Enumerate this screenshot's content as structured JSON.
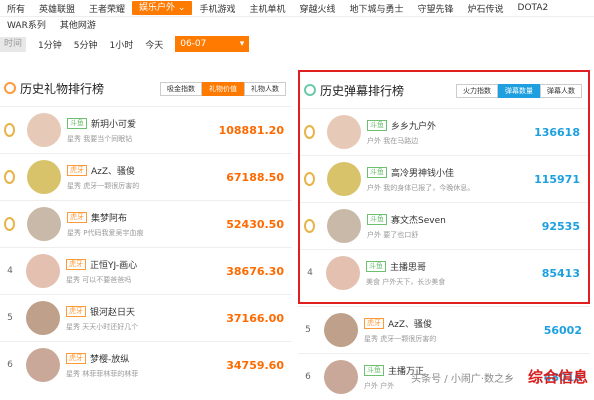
{
  "gamebar": {
    "items": [
      "所有",
      "英雄联盟",
      "王者荣耀",
      "娱乐户外 ⌄",
      "手机游戏",
      "主机单机",
      "穿越火线",
      "地下城与勇士",
      "守望先锋",
      "炉石传说",
      "DOTA2"
    ],
    "items2": [
      "WAR系列",
      "其他网游"
    ],
    "active_index": 3
  },
  "timebar": {
    "label": "时间",
    "options": [
      "1分钟",
      "5分钟",
      "1小时",
      "今天"
    ],
    "selected": "06-07",
    "arrow": "▾"
  },
  "left": {
    "title": "历史礼物排行榜",
    "tabs": [
      "吸金指数",
      "礼物价值",
      "礼物人数"
    ],
    "items": [
      {
        "rank": "",
        "tag": "斗鱼",
        "name": "新玥小可爱",
        "desc": "星秀 我要当个同眠钻",
        "value": "108881.20"
      },
      {
        "rank": "",
        "tag": "虎牙",
        "name": "AzZ、骚俊",
        "desc": "星秀 虎牙一颗很厉害的",
        "value": "67188.50"
      },
      {
        "rank": "",
        "tag": "虎牙",
        "name": "集梦阿布",
        "desc": "星秀 P代码我爱吴宇血痕",
        "value": "52430.50"
      },
      {
        "rank": "4",
        "tag": "虎牙",
        "name": "正恒YJ-画心",
        "desc": "星秀 可以不要爸爸吗",
        "value": "38676.30"
      },
      {
        "rank": "5",
        "tag": "虎牙",
        "name": "银河赵日天",
        "desc": "星秀 天天小时还好几个",
        "value": "37166.00"
      },
      {
        "rank": "6",
        "tag": "虎牙",
        "name": "梦樱-放纵",
        "desc": "星秀 林菲菲林菲的林菲",
        "value": "34759.60"
      }
    ]
  },
  "right": {
    "title": "历史弹幕排行榜",
    "tabs": [
      "火力指数",
      "弹幕数量",
      "弹幕人数"
    ],
    "items": [
      {
        "rank": "",
        "tag": "斗鱼",
        "name": "乡乡九户外",
        "desc": "户外 我在马路边",
        "value": "136618"
      },
      {
        "rank": "",
        "tag": "斗鱼",
        "name": "高冷男神钱小佳",
        "desc": "户外 我的身体已报了，今晚休息。",
        "value": "115971"
      },
      {
        "rank": "",
        "tag": "斗鱼",
        "name": "寡文杰Seven",
        "desc": "户外 要了也口舒",
        "value": "92535"
      },
      {
        "rank": "4",
        "tag": "斗鱼",
        "name": "主播思哥",
        "desc": "美食 户外天下，长沙美食",
        "value": "85413"
      },
      {
        "rank": "5",
        "tag": "虎牙",
        "name": "AzZ、骚俊",
        "desc": "星秀 虎牙一颗很厉害的",
        "value": "56002"
      },
      {
        "rank": "6",
        "tag": "斗鱼",
        "name": "主播万正",
        "desc": "户外 户外",
        "value": "48016"
      }
    ]
  },
  "watermark": "综合信息",
  "watermark2": "头条号 / 小闹广·数之乡"
}
